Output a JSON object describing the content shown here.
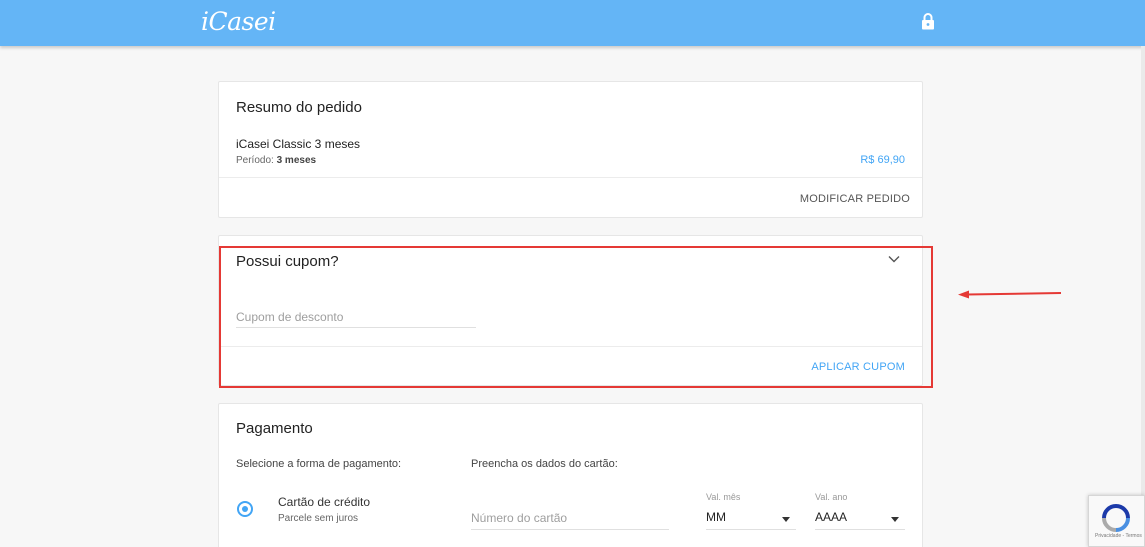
{
  "header": {
    "logo": "iCasei",
    "lock_icon": "lock-icon",
    "color": "#64b5f6"
  },
  "summary": {
    "title": "Resumo do pedido",
    "plan": "iCasei Classic 3 meses",
    "period_label": "Período:",
    "period_value": "3 meses",
    "price": "R$ 69,90",
    "modify": "MODIFICAR PEDIDO"
  },
  "coupon": {
    "title": "Possui cupom?",
    "placeholder": "Cupom de desconto",
    "value": "",
    "apply": "APLICAR CUPOM",
    "toggle_icon": "chevron-down-icon"
  },
  "annotation": {
    "highlight_color": "#e53935"
  },
  "payment": {
    "title": "Pagamento",
    "method_label": "Selecione a forma de pagamento:",
    "card_label": "Preencha os dados do cartão:",
    "option_title": "Cartão de crédito",
    "option_sub": "Parcele sem juros",
    "option_selected": true,
    "card_placeholder": "Número do cartão",
    "month_caption": "Val. mês",
    "month_value": "MM",
    "year_caption": "Val. ano",
    "year_value": "AAAA"
  },
  "recaptcha": {
    "terms": "Privacidade - Termos"
  },
  "colors": {
    "accent": "#42a5f5"
  }
}
